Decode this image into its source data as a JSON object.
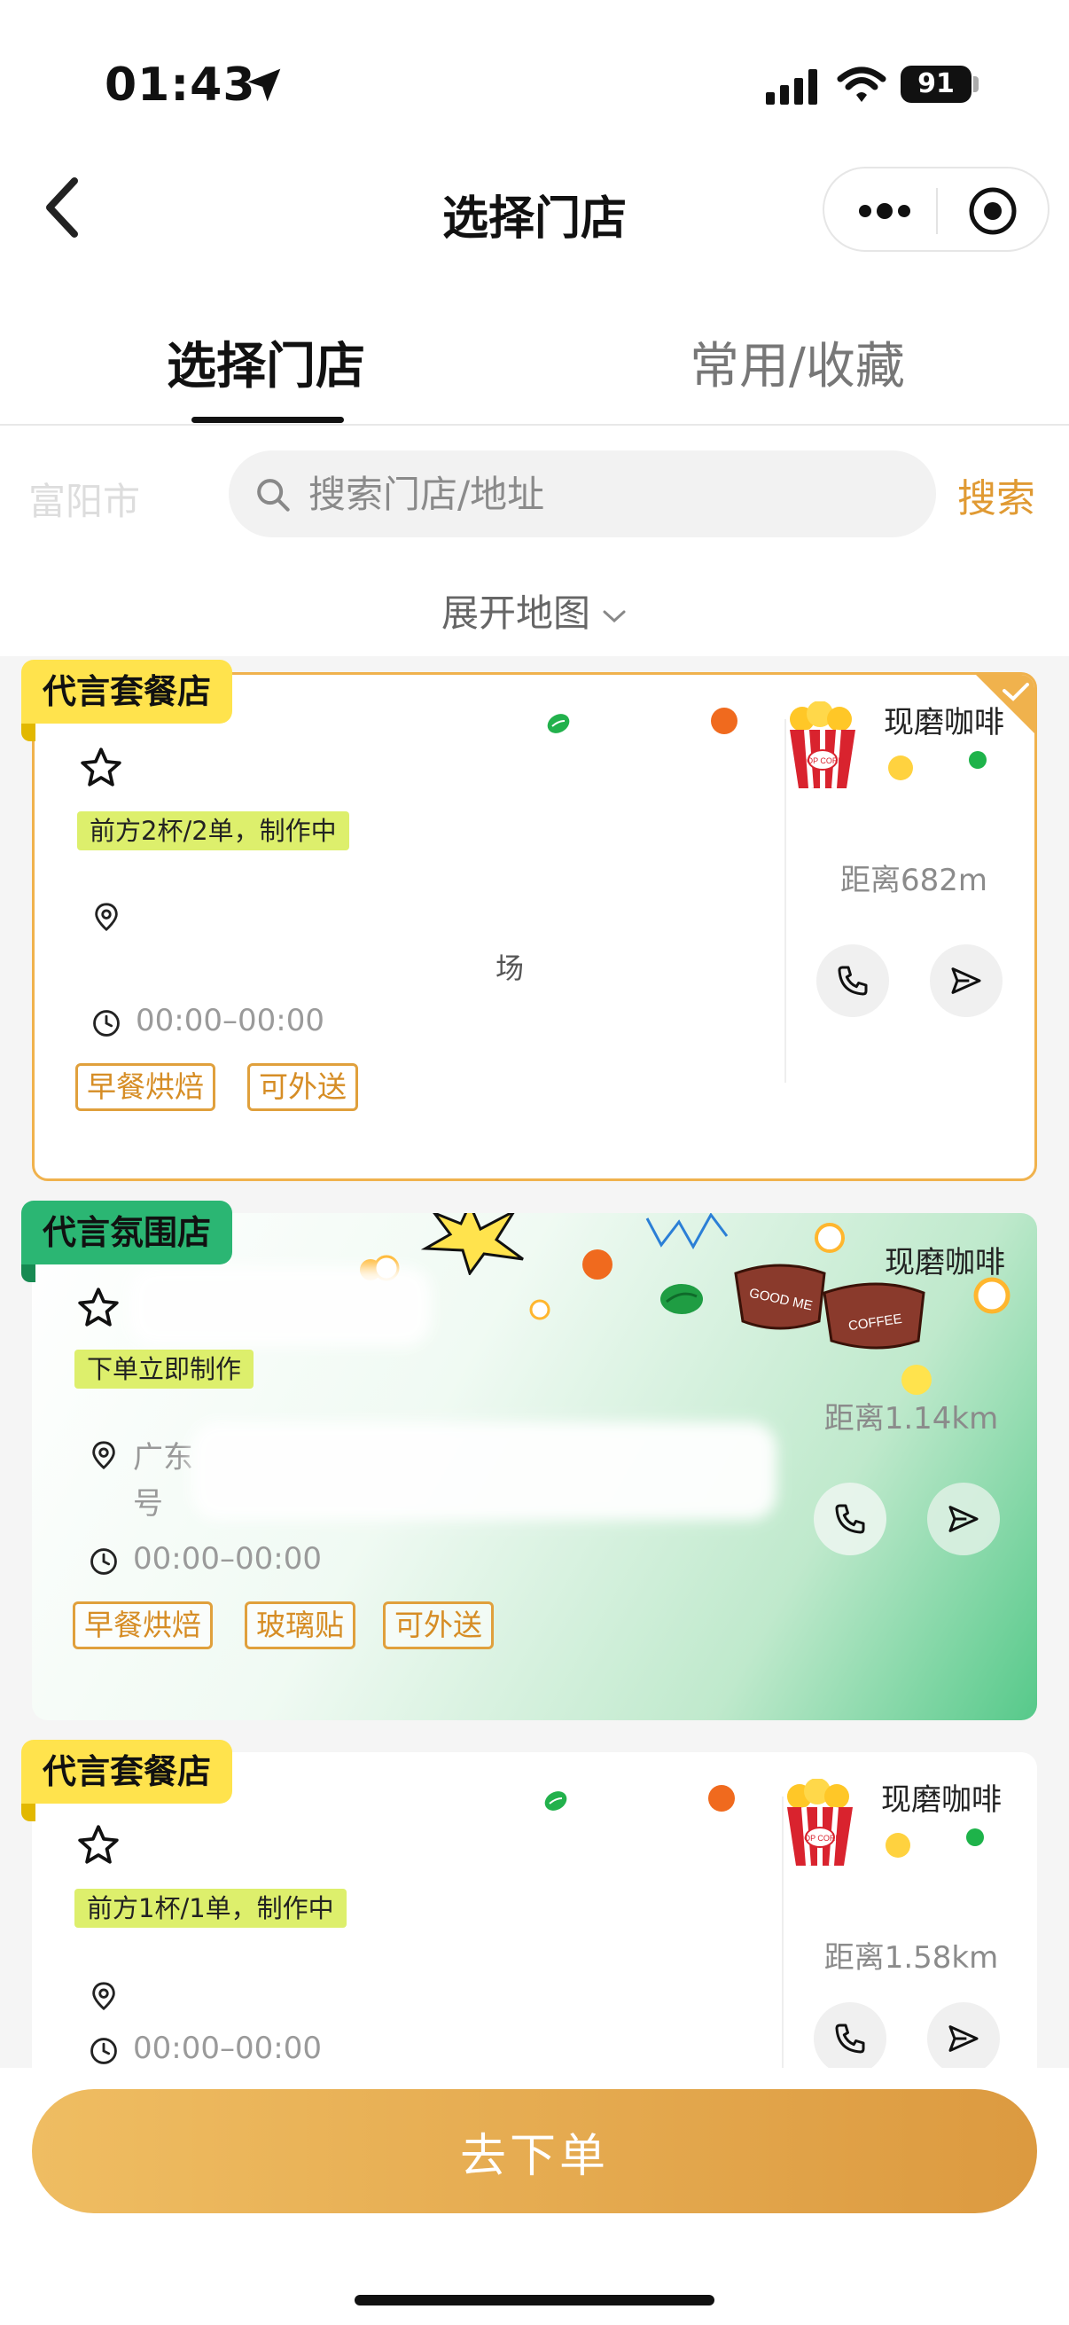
{
  "status_bar": {
    "time": "01:43",
    "battery": "91"
  },
  "nav": {
    "title": "选择门店"
  },
  "tabs": [
    {
      "label": "选择门店"
    },
    {
      "label": "常用/收藏"
    }
  ],
  "search": {
    "city": "富阳市",
    "placeholder": "搜索门店/地址",
    "button": "搜索"
  },
  "map_toggle": {
    "label": "展开地图"
  },
  "stores": [
    {
      "badge": "代言套餐店",
      "queue_status": "前方2杯/2单，制作中",
      "address_partial": "场",
      "hours": "00:00–00:00",
      "tags": [
        "早餐烘焙",
        "可外送"
      ],
      "category": "现磨咖啡",
      "distance": "距离682m",
      "selected": true
    },
    {
      "badge": "代言氛围店",
      "queue_status": "下单立即制作",
      "address_partial": "广东",
      "address_line2": "号",
      "hours": "00:00–00:00",
      "tags": [
        "早餐烘焙",
        "玻璃贴",
        "可外送"
      ],
      "category": "现磨咖啡",
      "distance": "距离1.14km",
      "selected": false
    },
    {
      "badge": "代言套餐店",
      "queue_status": "前方1杯/1单，制作中",
      "hours": "00:00–00:00",
      "category": "现磨咖啡",
      "distance": "距离1.58km",
      "selected": false
    }
  ],
  "decor": {
    "mug_text_1": "GOOD ME",
    "mug_text_2": "COFFEE",
    "popcorn_text": "POP CORN"
  },
  "order_button": {
    "label": "去下单"
  },
  "colors": {
    "accent": "#e09a33",
    "badge_yellow": "#ffe34d",
    "badge_green": "#2bb673",
    "queue_bg": "#ddef6c"
  }
}
